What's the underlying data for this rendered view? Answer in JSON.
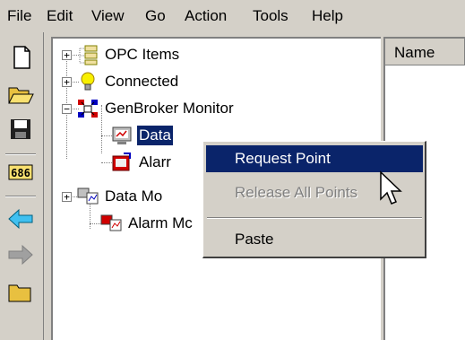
{
  "menubar": {
    "items": [
      "File",
      "Edit",
      "View",
      "Go",
      "Action",
      "Tools",
      "Help"
    ]
  },
  "toolbar": {
    "icons": [
      "new-document-icon",
      "open-folder-icon",
      "save-disk-icon",
      "data-value-icon",
      "back-arrow-icon",
      "forward-arrow-icon",
      "folder-icon"
    ],
    "counter_label": "686"
  },
  "tree": {
    "items": [
      {
        "label": "OPC Items",
        "icon": "opc-items-icon",
        "expander": "+"
      },
      {
        "label": "Connected",
        "icon": "lightbulb-icon",
        "expander": "+"
      },
      {
        "label": "GenBroker Monitor",
        "icon": "genbroker-icon",
        "expander": "−"
      },
      {
        "label": "Data",
        "icon": "data-monitor-icon",
        "selected": true
      },
      {
        "label": "Alarr",
        "icon": "alarm-monitor-icon"
      },
      {
        "label": "Data Mo",
        "icon": "data-mo-icon",
        "expander": "+"
      },
      {
        "label": "Alarm Mc",
        "icon": "alarm-mc-icon"
      }
    ]
  },
  "list": {
    "column_header": "Name"
  },
  "context_menu": {
    "items": [
      {
        "label": "Request Point",
        "state": "highlighted"
      },
      {
        "label": "Release All Points",
        "state": "disabled"
      },
      {
        "label": "Paste",
        "state": "normal"
      }
    ]
  },
  "colors": {
    "face": "#d4d0c8",
    "highlight": "#0a246a",
    "shadow": "#808080"
  }
}
